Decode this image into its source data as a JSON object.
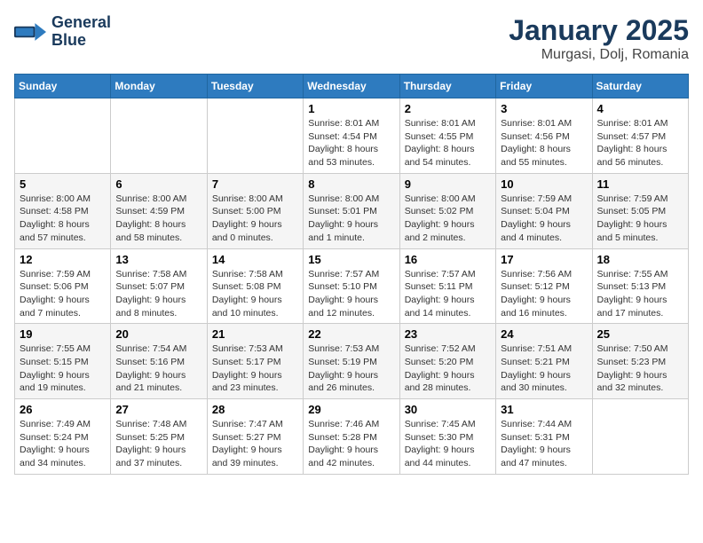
{
  "header": {
    "logo_line1": "General",
    "logo_line2": "Blue",
    "month_year": "January 2025",
    "location": "Murgasi, Dolj, Romania"
  },
  "weekdays": [
    "Sunday",
    "Monday",
    "Tuesday",
    "Wednesday",
    "Thursday",
    "Friday",
    "Saturday"
  ],
  "weeks": [
    [
      {
        "day": "",
        "info": ""
      },
      {
        "day": "",
        "info": ""
      },
      {
        "day": "",
        "info": ""
      },
      {
        "day": "1",
        "info": "Sunrise: 8:01 AM\nSunset: 4:54 PM\nDaylight: 8 hours and 53 minutes."
      },
      {
        "day": "2",
        "info": "Sunrise: 8:01 AM\nSunset: 4:55 PM\nDaylight: 8 hours and 54 minutes."
      },
      {
        "day": "3",
        "info": "Sunrise: 8:01 AM\nSunset: 4:56 PM\nDaylight: 8 hours and 55 minutes."
      },
      {
        "day": "4",
        "info": "Sunrise: 8:01 AM\nSunset: 4:57 PM\nDaylight: 8 hours and 56 minutes."
      }
    ],
    [
      {
        "day": "5",
        "info": "Sunrise: 8:00 AM\nSunset: 4:58 PM\nDaylight: 8 hours and 57 minutes."
      },
      {
        "day": "6",
        "info": "Sunrise: 8:00 AM\nSunset: 4:59 PM\nDaylight: 8 hours and 58 minutes."
      },
      {
        "day": "7",
        "info": "Sunrise: 8:00 AM\nSunset: 5:00 PM\nDaylight: 9 hours and 0 minutes."
      },
      {
        "day": "8",
        "info": "Sunrise: 8:00 AM\nSunset: 5:01 PM\nDaylight: 9 hours and 1 minute."
      },
      {
        "day": "9",
        "info": "Sunrise: 8:00 AM\nSunset: 5:02 PM\nDaylight: 9 hours and 2 minutes."
      },
      {
        "day": "10",
        "info": "Sunrise: 7:59 AM\nSunset: 5:04 PM\nDaylight: 9 hours and 4 minutes."
      },
      {
        "day": "11",
        "info": "Sunrise: 7:59 AM\nSunset: 5:05 PM\nDaylight: 9 hours and 5 minutes."
      }
    ],
    [
      {
        "day": "12",
        "info": "Sunrise: 7:59 AM\nSunset: 5:06 PM\nDaylight: 9 hours and 7 minutes."
      },
      {
        "day": "13",
        "info": "Sunrise: 7:58 AM\nSunset: 5:07 PM\nDaylight: 9 hours and 8 minutes."
      },
      {
        "day": "14",
        "info": "Sunrise: 7:58 AM\nSunset: 5:08 PM\nDaylight: 9 hours and 10 minutes."
      },
      {
        "day": "15",
        "info": "Sunrise: 7:57 AM\nSunset: 5:10 PM\nDaylight: 9 hours and 12 minutes."
      },
      {
        "day": "16",
        "info": "Sunrise: 7:57 AM\nSunset: 5:11 PM\nDaylight: 9 hours and 14 minutes."
      },
      {
        "day": "17",
        "info": "Sunrise: 7:56 AM\nSunset: 5:12 PM\nDaylight: 9 hours and 16 minutes."
      },
      {
        "day": "18",
        "info": "Sunrise: 7:55 AM\nSunset: 5:13 PM\nDaylight: 9 hours and 17 minutes."
      }
    ],
    [
      {
        "day": "19",
        "info": "Sunrise: 7:55 AM\nSunset: 5:15 PM\nDaylight: 9 hours and 19 minutes."
      },
      {
        "day": "20",
        "info": "Sunrise: 7:54 AM\nSunset: 5:16 PM\nDaylight: 9 hours and 21 minutes."
      },
      {
        "day": "21",
        "info": "Sunrise: 7:53 AM\nSunset: 5:17 PM\nDaylight: 9 hours and 23 minutes."
      },
      {
        "day": "22",
        "info": "Sunrise: 7:53 AM\nSunset: 5:19 PM\nDaylight: 9 hours and 26 minutes."
      },
      {
        "day": "23",
        "info": "Sunrise: 7:52 AM\nSunset: 5:20 PM\nDaylight: 9 hours and 28 minutes."
      },
      {
        "day": "24",
        "info": "Sunrise: 7:51 AM\nSunset: 5:21 PM\nDaylight: 9 hours and 30 minutes."
      },
      {
        "day": "25",
        "info": "Sunrise: 7:50 AM\nSunset: 5:23 PM\nDaylight: 9 hours and 32 minutes."
      }
    ],
    [
      {
        "day": "26",
        "info": "Sunrise: 7:49 AM\nSunset: 5:24 PM\nDaylight: 9 hours and 34 minutes."
      },
      {
        "day": "27",
        "info": "Sunrise: 7:48 AM\nSunset: 5:25 PM\nDaylight: 9 hours and 37 minutes."
      },
      {
        "day": "28",
        "info": "Sunrise: 7:47 AM\nSunset: 5:27 PM\nDaylight: 9 hours and 39 minutes."
      },
      {
        "day": "29",
        "info": "Sunrise: 7:46 AM\nSunset: 5:28 PM\nDaylight: 9 hours and 42 minutes."
      },
      {
        "day": "30",
        "info": "Sunrise: 7:45 AM\nSunset: 5:30 PM\nDaylight: 9 hours and 44 minutes."
      },
      {
        "day": "31",
        "info": "Sunrise: 7:44 AM\nSunset: 5:31 PM\nDaylight: 9 hours and 47 minutes."
      },
      {
        "day": "",
        "info": ""
      }
    ]
  ]
}
